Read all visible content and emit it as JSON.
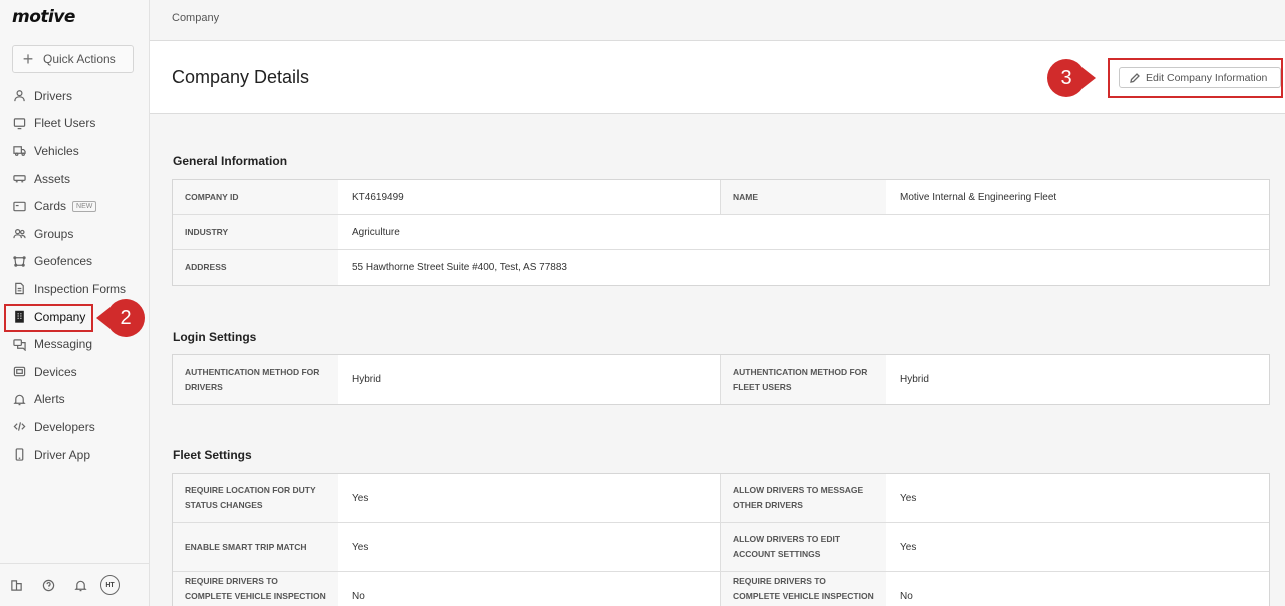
{
  "sidebar": {
    "logo": "motive",
    "quick_actions": "Quick Actions",
    "items": [
      {
        "label": "Drivers",
        "icon": "user-icon"
      },
      {
        "label": "Fleet Users",
        "icon": "monitor-icon"
      },
      {
        "label": "Vehicles",
        "icon": "truck-icon"
      },
      {
        "label": "Assets",
        "icon": "trailer-icon"
      },
      {
        "label": "Cards",
        "icon": "card-icon",
        "badge": "NEW"
      },
      {
        "label": "Groups",
        "icon": "users-icon"
      },
      {
        "label": "Geofences",
        "icon": "geofence-icon"
      },
      {
        "label": "Inspection Forms",
        "icon": "document-icon"
      },
      {
        "label": "Company",
        "icon": "building-icon",
        "active": true
      },
      {
        "label": "Messaging",
        "icon": "chat-icon"
      },
      {
        "label": "Devices",
        "icon": "device-icon"
      },
      {
        "label": "Alerts",
        "icon": "bell-icon"
      },
      {
        "label": "Developers",
        "icon": "code-icon"
      },
      {
        "label": "Driver App",
        "icon": "phone-icon"
      }
    ],
    "avatar": "HT"
  },
  "callouts": {
    "two": "2",
    "three": "3"
  },
  "breadcrumb": "Company",
  "header": {
    "title": "Company Details",
    "edit_button": "Edit Company Information"
  },
  "general": {
    "title": "General Information",
    "company_id_label": "COMPANY ID",
    "company_id": "KT4619499",
    "name_label": "NAME",
    "name": "Motive Internal & Engineering Fleet",
    "industry_label": "INDUSTRY",
    "industry": "Agriculture",
    "address_label": "ADDRESS",
    "address": "55 Hawthorne Street Suite #400, Test, AS 77883"
  },
  "login": {
    "title": "Login Settings",
    "drivers_label": "AUTHENTICATION METHOD FOR DRIVERS",
    "drivers_value": "Hybrid",
    "fleet_label": "AUTHENTICATION METHOD FOR FLEET USERS",
    "fleet_value": "Hybrid"
  },
  "fleet": {
    "title": "Fleet Settings",
    "rows": [
      {
        "l1": "REQUIRE LOCATION FOR DUTY STATUS CHANGES",
        "v1": "Yes",
        "l2": "ALLOW DRIVERS TO MESSAGE OTHER DRIVERS",
        "v2": "Yes"
      },
      {
        "l1": "ENABLE SMART TRIP MATCH",
        "v1": "Yes",
        "l2": "ALLOW DRIVERS TO EDIT ACCOUNT SETTINGS",
        "v2": "Yes"
      },
      {
        "l1": "REQUIRE DRIVERS TO COMPLETE VEHICLE INSPECTION BEFORE",
        "v1": "No",
        "l2": "REQUIRE DRIVERS TO COMPLETE VEHICLE INSPECTION BEFORE",
        "v2": "No"
      }
    ]
  }
}
